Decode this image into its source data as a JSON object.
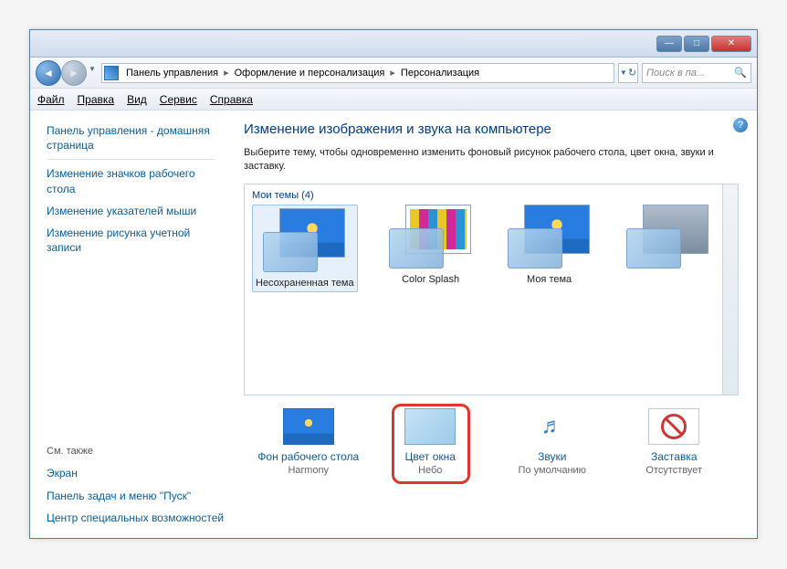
{
  "window": {
    "min": "—",
    "max": "□",
    "close": "✕"
  },
  "breadcrumb": {
    "items": [
      "Панель управления",
      "Оформление и персонализация",
      "Персонализация"
    ],
    "sep": "▸",
    "refresh": "↻"
  },
  "search": {
    "placeholder": "Поиск в па...",
    "icon": "🔍"
  },
  "menu": {
    "file": "Файл",
    "edit": "Правка",
    "view": "Вид",
    "tools": "Сервис",
    "help": "Справка"
  },
  "sidebar": {
    "items": [
      "Панель управления - домашняя страница",
      "Изменение значков рабочего стола",
      "Изменение указателей мыши",
      "Изменение рисунка учетной записи"
    ],
    "footer_hdr": "См. также",
    "footer": [
      "Экран",
      "Панель задач и меню \"Пуск\"",
      "Центр специальных возможностей"
    ]
  },
  "content": {
    "help": "?",
    "title": "Изменение изображения и звука на компьютере",
    "desc": "Выберите тему, чтобы одновременно изменить фоновый рисунок рабочего стола, цвет окна, звуки и заставку.",
    "themes_hdr": "Мои темы (4)",
    "themes": [
      {
        "label": "Несохраненная тема",
        "bg": "win",
        "selected": true
      },
      {
        "label": "Color Splash",
        "bg": "splash",
        "selected": false
      },
      {
        "label": "Моя тема",
        "bg": "win",
        "selected": false
      },
      {
        "label": "",
        "bg": "gray",
        "selected": false
      }
    ]
  },
  "bottom": [
    {
      "link": "Фон рабочего стола",
      "sub": "Harmony",
      "ic": "desk"
    },
    {
      "link": "Цвет окна",
      "sub": "Небо",
      "ic": "wincol"
    },
    {
      "link": "Звуки",
      "sub": "По умолчанию",
      "ic": "sound",
      "glyph": "♬"
    },
    {
      "link": "Заставка",
      "sub": "Отсутствует",
      "ic": "saver"
    }
  ],
  "highlight_index": 1
}
